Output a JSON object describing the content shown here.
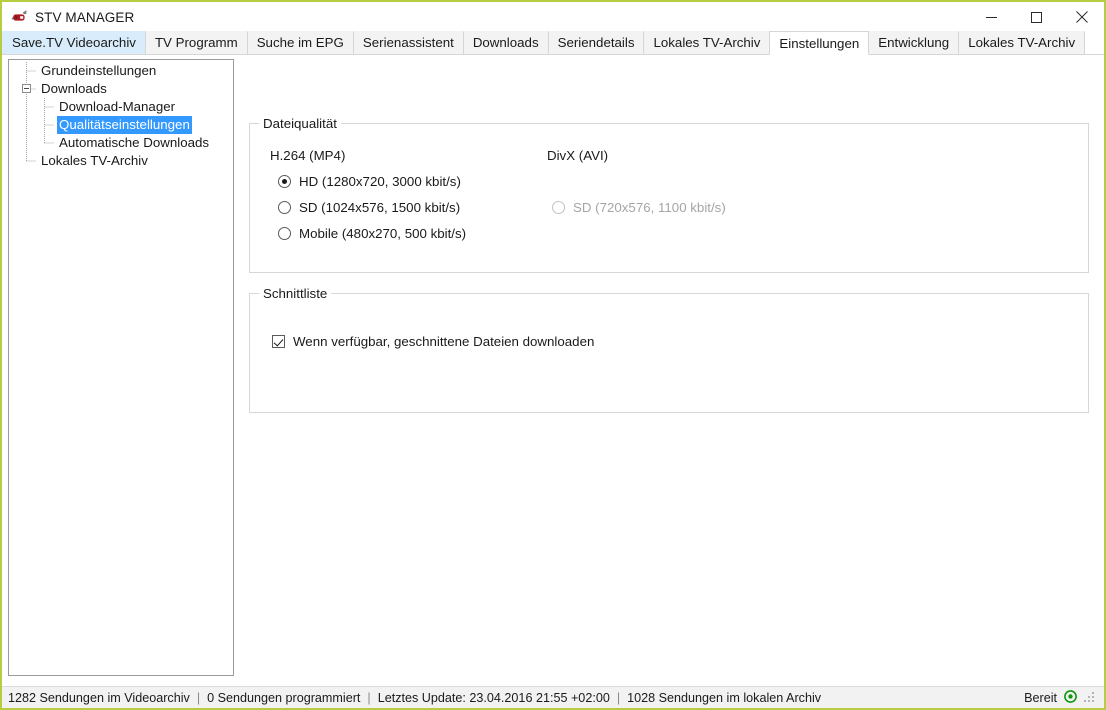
{
  "window": {
    "title": "STV MANAGER",
    "icon": "app-ribbon-icon",
    "border_color": "#b7cc41",
    "minimize_label": "Minimieren",
    "maximize_label": "Maximieren",
    "close_label": "Schließen"
  },
  "tabs": [
    {
      "label": "Save.TV Videoarchiv",
      "state": "hover"
    },
    {
      "label": "TV Programm",
      "state": "normal"
    },
    {
      "label": "Suche im EPG",
      "state": "normal"
    },
    {
      "label": "Serienassistent",
      "state": "normal"
    },
    {
      "label": "Downloads",
      "state": "normal"
    },
    {
      "label": "Seriendetails",
      "state": "normal"
    },
    {
      "label": "Lokales TV-Archiv",
      "state": "normal"
    },
    {
      "label": "Einstellungen",
      "state": "active"
    },
    {
      "label": "Entwicklung",
      "state": "normal"
    },
    {
      "label": "Lokales TV-Archiv",
      "state": "normal"
    }
  ],
  "tree": {
    "nodes": [
      {
        "label": "Grundeinstellungen",
        "level": 1,
        "selected": false,
        "expander": false
      },
      {
        "label": "Downloads",
        "level": 1,
        "selected": false,
        "expander": true
      },
      {
        "label": "Download-Manager",
        "level": 2,
        "selected": false,
        "expander": false
      },
      {
        "label": "Qualitätseinstellungen",
        "level": 2,
        "selected": true,
        "expander": false
      },
      {
        "label": "Automatische Downloads",
        "level": 2,
        "selected": false,
        "expander": false
      },
      {
        "label": "Lokales TV-Archiv",
        "level": 1,
        "selected": false,
        "expander": false
      }
    ],
    "selection_color": "#3399ff"
  },
  "settings": {
    "dateiqualitaet": {
      "title": "Dateiqualität",
      "columns": [
        {
          "header": "H.264 (MP4)",
          "options": [
            {
              "label": "HD (1280x720, 3000 kbit/s)",
              "checked": true,
              "disabled": false
            },
            {
              "label": "SD (1024x576, 1500 kbit/s)",
              "checked": false,
              "disabled": false
            },
            {
              "label": "Mobile (480x270, 500 kbit/s)",
              "checked": false,
              "disabled": false
            }
          ]
        },
        {
          "header": "DivX (AVI)",
          "options": [
            {
              "label": "SD (720x576, 1100 kbit/s)",
              "checked": false,
              "disabled": true
            }
          ]
        }
      ]
    },
    "schnittliste": {
      "title": "Schnittliste",
      "checkbox": {
        "label": "Wenn verfügbar, geschnittene Dateien downloaden",
        "checked": true
      }
    }
  },
  "statusbar": {
    "segments": [
      "1282 Sendungen im Videoarchiv",
      "0 Sendungen programmiert",
      "Letztes Update: 23.04.2016 21:55 +02:00",
      "1028 Sendungen im lokalen Archiv"
    ],
    "separator": "|",
    "status_label": "Bereit",
    "status_icon": "green-circle-icon",
    "status_color": "#1a9a1a",
    "grip_icon": "resize-grip-icon"
  }
}
